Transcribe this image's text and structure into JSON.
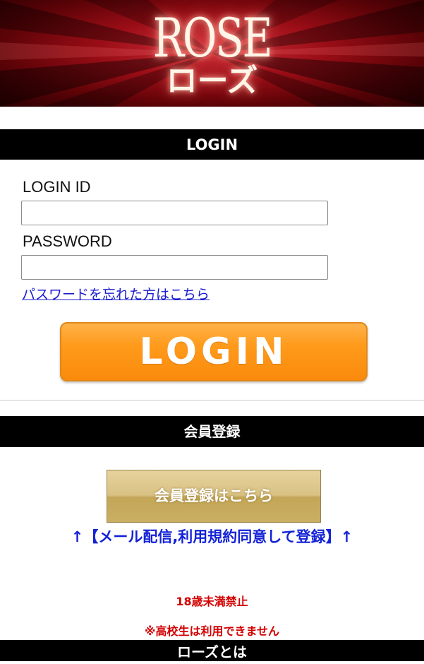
{
  "banner": {
    "logo_en": "ROSE",
    "logo_ja": "ローズ"
  },
  "login_section": {
    "header": "LOGIN",
    "id_label": "LOGIN ID",
    "id_value": "",
    "password_label": "PASSWORD",
    "password_value": "",
    "forgot_link": "パスワードを忘れた方はこちら",
    "login_button": "LOGIN"
  },
  "member_section": {
    "header": "会員登録",
    "register_button": "会員登録はこちら",
    "consent_note": "↑【メール配信,利用規約同意して登録】↑",
    "age_notice": "18歳未満禁止",
    "student_notice": "※高校生は利用できません"
  },
  "about_section": {
    "header": "ローズとは"
  },
  "colors": {
    "banner_red": "#9a0d16",
    "section_bar": "#000000",
    "login_button": "#ff9a1a",
    "register_button": "#d9c184",
    "link_blue": "#1a1ad0",
    "notice_red": "#d40000"
  }
}
